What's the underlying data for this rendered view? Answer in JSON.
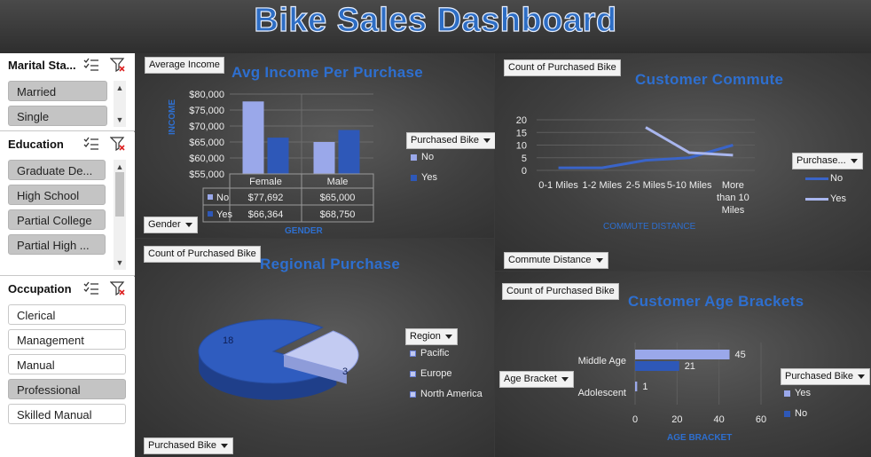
{
  "title": "Bike Sales Dashboard",
  "colors": {
    "no": "#9aa8ea",
    "yes": "#2e58b8",
    "title_blue": "#2e6fcf"
  },
  "slicers": {
    "marital": {
      "title": "Marital Sta...",
      "items": [
        {
          "label": "Married",
          "selected": true
        },
        {
          "label": "Single",
          "selected": true
        }
      ]
    },
    "education": {
      "title": "Education",
      "items": [
        {
          "label": "Graduate De...",
          "selected": true
        },
        {
          "label": "High School",
          "selected": true
        },
        {
          "label": "Partial College",
          "selected": true
        },
        {
          "label": "Partial High ...",
          "selected": true
        }
      ]
    },
    "occupation": {
      "title": "Occupation",
      "items": [
        {
          "label": "Clerical",
          "selected": false
        },
        {
          "label": "Management",
          "selected": false
        },
        {
          "label": "Manual",
          "selected": false
        },
        {
          "label": "Professional",
          "selected": true
        },
        {
          "label": "Skilled Manual",
          "selected": false
        }
      ]
    }
  },
  "income_chart": {
    "value_button": "Average Income",
    "axis_button": "Gender",
    "legend_button": "Purchased Bike",
    "chart_data": {
      "type": "bar",
      "title": "Avg Income Per Purchase",
      "xlabel": "GENDER",
      "ylabel": "INCOME",
      "categories": [
        "Female",
        "Male"
      ],
      "series": [
        {
          "name": "No",
          "values": [
            77692,
            65000
          ]
        },
        {
          "name": "Yes",
          "values": [
            66364,
            68750
          ]
        }
      ],
      "yticks": [
        "$80,000",
        "$75,000",
        "$70,000",
        "$65,000",
        "$60,000",
        "$55,000"
      ],
      "ylim": [
        55000,
        80000
      ],
      "table": [
        [
          "No",
          "$77,692",
          "$65,000"
        ],
        [
          "Yes",
          "$66,364",
          "$68,750"
        ]
      ],
      "grid": true,
      "legend": "right"
    }
  },
  "commute_chart": {
    "value_button": "Count of Purchased Bike",
    "axis_button": "Commute Distance",
    "legend_button": "Purchase...",
    "chart_data": {
      "type": "line",
      "title": "Customer Commute",
      "xlabel": "COMMUTE DISTANCE",
      "categories": [
        "0-1 Miles",
        "1-2 Miles",
        "2-5 Miles",
        "5-10 Miles",
        "More than 10 Miles"
      ],
      "series": [
        {
          "name": "No",
          "values": [
            1,
            1,
            4,
            5,
            10
          ]
        },
        {
          "name": "Yes",
          "values": [
            null,
            null,
            17,
            7,
            6
          ]
        }
      ],
      "yticks": [
        "20",
        "15",
        "10",
        "5",
        "0"
      ],
      "ylim": [
        0,
        20
      ],
      "grid": true,
      "legend": "right"
    }
  },
  "region_chart": {
    "value_button": "Count of Purchased Bike",
    "filter_button": "Purchased Bike",
    "legend_button": "Region",
    "chart_data": {
      "type": "pie",
      "title": "Regional Purchase",
      "categories": [
        "Pacific",
        "Europe",
        "North America"
      ],
      "values": [
        3,
        0,
        18
      ],
      "data_labels": [
        "18",
        "3"
      ],
      "legend": "right"
    }
  },
  "age_chart": {
    "value_button": "Count of Purchased Bike",
    "axis_button": "Age Bracket",
    "legend_button": "Purchased Bike",
    "chart_data": {
      "type": "bar",
      "title": "Customer Age Brackets",
      "xlabel": "AGE BRACKET",
      "categories": [
        "Middle Age",
        "Adolescent"
      ],
      "series": [
        {
          "name": "Yes",
          "values": [
            45,
            1
          ]
        },
        {
          "name": "No",
          "values": [
            21,
            0
          ]
        }
      ],
      "data_labels": [
        [
          "45",
          "1"
        ],
        [
          "21",
          ""
        ]
      ],
      "xticks": [
        "0",
        "20",
        "40",
        "60"
      ],
      "xlim": [
        0,
        60
      ],
      "grid": true,
      "legend": "right"
    }
  }
}
